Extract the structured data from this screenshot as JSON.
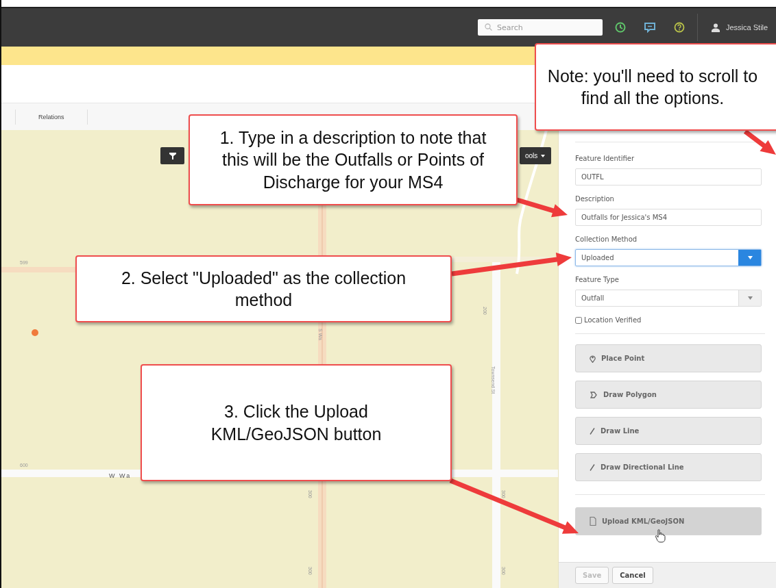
{
  "top_bar": {
    "search": {
      "placeholder": "Search"
    },
    "user_name": "Jessica Stile"
  },
  "tabs": [
    {
      "label": "Relations"
    }
  ],
  "map": {
    "tools_button": "ools",
    "labels": [
      {
        "kind": "flat",
        "text": "599"
      },
      {
        "kind": "vertical",
        "text": "S Wa"
      },
      {
        "kind": "vertical",
        "text": "200"
      },
      {
        "kind": "vertical",
        "text": "Townsend St"
      },
      {
        "kind": "flat",
        "text": "600"
      },
      {
        "kind": "street",
        "text": "W Wa"
      },
      {
        "kind": "vertical",
        "text": "300"
      },
      {
        "kind": "vertical",
        "text": "300"
      },
      {
        "kind": "vertical",
        "text": "300"
      },
      {
        "kind": "vertical",
        "text": "300"
      }
    ]
  },
  "form": {
    "fields": [
      {
        "kind": "text",
        "label": "Feature Identifier",
        "value": "OUTFL",
        "focused": false
      },
      {
        "kind": "text",
        "label": "Description",
        "value": "Outfalls for Jessica's MS4",
        "focused": false
      },
      {
        "kind": "select",
        "label": "Collection Method",
        "value": "Uploaded",
        "focused": true
      },
      {
        "kind": "select",
        "label": "Feature Type",
        "value": "Outfall",
        "focused": false
      }
    ],
    "location_verified": {
      "label": "Location Verified",
      "checked": false
    },
    "tool_buttons": [
      {
        "kind": "point",
        "label": "Place Point",
        "hovered": false
      },
      {
        "kind": "polygon",
        "label": "Draw Polygon",
        "hovered": false
      },
      {
        "kind": "line",
        "label": "Draw Line",
        "hovered": false
      },
      {
        "kind": "line",
        "label": "Draw Directional Line",
        "hovered": false
      }
    ],
    "upload_button": {
      "label": "Upload KML/GeoJSON",
      "hovered": true
    },
    "footer_buttons": [
      {
        "label": "Save",
        "disabled": true
      },
      {
        "label": "Cancel",
        "disabled": false
      }
    ]
  },
  "callouts": [
    {
      "text": "Note: you'll need to scroll to find all the options."
    },
    {
      "text": "1. Type in a description to note that this will be the Outfalls or Points of Discharge for your MS4"
    },
    {
      "text": "2. Select \"Uploaded\" as the collection method"
    },
    {
      "text": "3. Click the Upload KML/GeoJSON button"
    }
  ]
}
